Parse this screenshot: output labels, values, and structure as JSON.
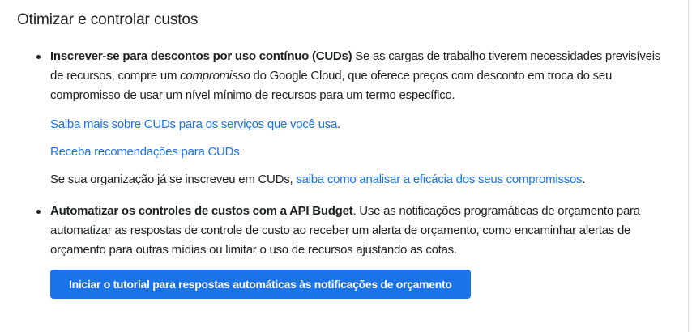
{
  "section": {
    "title": "Otimizar e controlar custos",
    "cuds": {
      "bold": "Inscrever-se para descontos por uso contínuo (CUDs)",
      "text1": " Se as cargas de trabalho tiverem necessidades previsíveis de recursos, compre um ",
      "italic": "compromisso",
      "text2": " do Google Cloud, que oferece preços com desconto em troca do seu compromisso de usar um nível mínimo de recursos para um termo específico.",
      "link1": "Saiba mais sobre CUDs para os serviços que você usa",
      "link2": "Receba recomendações para CUDs",
      "org_text": "Se sua organização já se inscreveu em CUDs, ",
      "link3": "saiba como analisar a eficácia dos seus compromissos",
      "period": "."
    },
    "budget": {
      "bold": "Automatizar os controles de custos com a API Budget",
      "text": ". Use as notificações programáticas de orçamento para automatizar as respostas de controle de custo ao receber um alerta de orçamento, como encaminhar alertas de orçamento para outras mídias ou limitar o uso de recursos ajustando as cotas.",
      "button": "Iniciar o tutorial para respostas automáticas às notificações de orçamento"
    },
    "accent_color": "#1a73e8"
  }
}
